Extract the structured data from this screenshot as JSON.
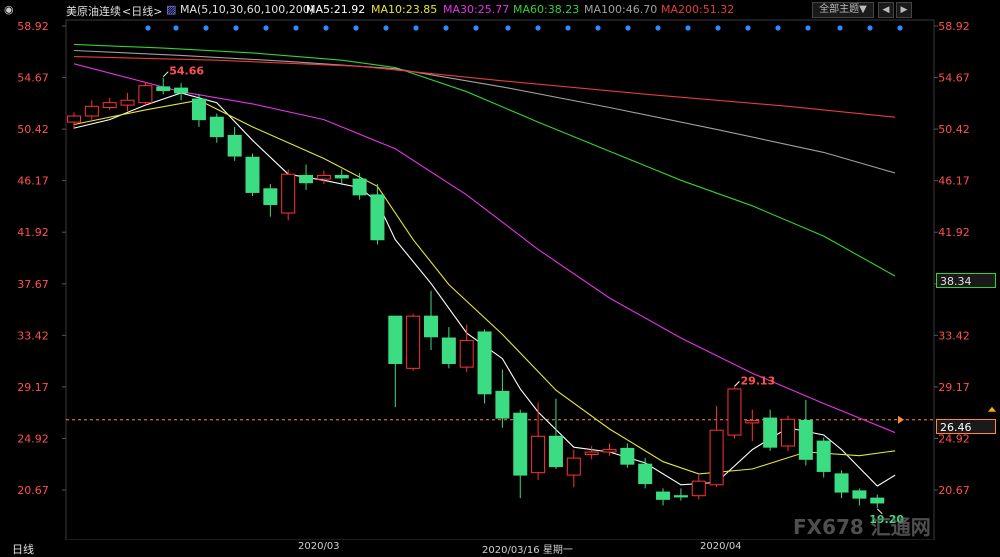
{
  "header": {
    "title": "美原油连续",
    "period_link": "<日线>",
    "ma_params": "MA(5,10,30,60,100,200)",
    "ma5": "MA5:21.92",
    "ma10": "MA10:23.85",
    "ma30": "MA30:25.77",
    "ma60": "MA60:38.23",
    "ma100": "MA100:46.70",
    "ma200": "MA200:51.32",
    "theme_button": "全部主题▼",
    "prev_button": "◀",
    "next_button": "▶"
  },
  "footer": {
    "period_tab": "日线",
    "date_labels": [
      "2020/03",
      "2020/03/16 星期一",
      "2020/04"
    ]
  },
  "price_tags": {
    "ma60_value": "38.34",
    "current_value": "26.46"
  },
  "colors": {
    "up": "#ff3232",
    "down": "#3cdc82",
    "ma5": "#ffffff",
    "ma10": "#e6e632",
    "ma30": "#e632e6",
    "ma60": "#32d232",
    "ma100": "#a0a0a0",
    "ma200": "#e63c3c",
    "axis_text": "#ff5050",
    "current_line": "#ff8c32"
  },
  "watermark": "FX678 汇通网",
  "chart_data": {
    "type": "candlestick",
    "title": "美原油连续 日线",
    "y_ticks": [
      58.92,
      54.67,
      50.42,
      46.17,
      41.92,
      37.67,
      33.42,
      29.17,
      24.92,
      20.67
    ],
    "ylim": [
      17.5,
      60.0
    ],
    "annotations": [
      {
        "label": "54.66",
        "index": 5,
        "value": 54.66,
        "type": "high"
      },
      {
        "label": "29.13",
        "index": 37,
        "value": 29.13,
        "type": "high"
      },
      {
        "label": "19.20",
        "index": 45,
        "value": 19.2,
        "type": "low"
      }
    ],
    "current_price": 26.46,
    "candles": [
      {
        "o": 51.0,
        "c": 51.5,
        "h": 51.8,
        "l": 50.4
      },
      {
        "o": 51.5,
        "c": 52.3,
        "h": 52.8,
        "l": 51.2
      },
      {
        "o": 52.2,
        "c": 52.6,
        "h": 53.0,
        "l": 52.0
      },
      {
        "o": 52.4,
        "c": 52.8,
        "h": 53.4,
        "l": 51.9
      },
      {
        "o": 52.6,
        "c": 54.0,
        "h": 54.3,
        "l": 52.4
      },
      {
        "o": 53.9,
        "c": 53.6,
        "h": 54.66,
        "l": 53.3
      },
      {
        "o": 53.8,
        "c": 53.4,
        "h": 54.2,
        "l": 52.8
      },
      {
        "o": 52.9,
        "c": 51.2,
        "h": 53.3,
        "l": 50.6
      },
      {
        "o": 51.4,
        "c": 49.8,
        "h": 51.7,
        "l": 49.3
      },
      {
        "o": 49.9,
        "c": 48.2,
        "h": 50.6,
        "l": 47.8
      },
      {
        "o": 48.1,
        "c": 45.2,
        "h": 48.4,
        "l": 44.9
      },
      {
        "o": 45.5,
        "c": 44.2,
        "h": 45.9,
        "l": 43.2
      },
      {
        "o": 43.5,
        "c": 46.7,
        "h": 47.1,
        "l": 42.9
      },
      {
        "o": 46.6,
        "c": 46.0,
        "h": 47.5,
        "l": 45.4
      },
      {
        "o": 46.3,
        "c": 46.6,
        "h": 47.0,
        "l": 45.9
      },
      {
        "o": 46.6,
        "c": 46.4,
        "h": 47.1,
        "l": 45.8
      },
      {
        "o": 46.3,
        "c": 45.0,
        "h": 46.8,
        "l": 44.6
      },
      {
        "o": 45.0,
        "c": 41.3,
        "h": 45.9,
        "l": 40.9
      },
      {
        "o": 35.0,
        "c": 31.1,
        "h": 35.0,
        "l": 27.5
      },
      {
        "o": 30.7,
        "c": 35.0,
        "h": 35.2,
        "l": 30.5
      },
      {
        "o": 35.0,
        "c": 33.3,
        "h": 37.1,
        "l": 32.2
      },
      {
        "o": 33.2,
        "c": 31.1,
        "h": 34.1,
        "l": 30.7
      },
      {
        "o": 30.8,
        "c": 33.0,
        "h": 34.3,
        "l": 30.4
      },
      {
        "o": 33.7,
        "c": 28.6,
        "h": 33.9,
        "l": 27.8
      },
      {
        "o": 28.8,
        "c": 26.6,
        "h": 30.6,
        "l": 25.8
      },
      {
        "o": 27.0,
        "c": 21.9,
        "h": 27.3,
        "l": 20.0
      },
      {
        "o": 22.1,
        "c": 25.1,
        "h": 27.9,
        "l": 21.5
      },
      {
        "o": 25.1,
        "c": 22.6,
        "h": 28.2,
        "l": 22.4
      },
      {
        "o": 21.9,
        "c": 23.3,
        "h": 24.0,
        "l": 20.9
      },
      {
        "o": 23.6,
        "c": 23.8,
        "h": 24.3,
        "l": 23.2
      },
      {
        "o": 23.8,
        "c": 24.0,
        "h": 24.5,
        "l": 23.5
      },
      {
        "o": 24.1,
        "c": 22.8,
        "h": 24.5,
        "l": 22.5
      },
      {
        "o": 22.8,
        "c": 21.2,
        "h": 23.3,
        "l": 20.8
      },
      {
        "o": 20.5,
        "c": 19.9,
        "h": 20.8,
        "l": 19.4
      },
      {
        "o": 20.2,
        "c": 20.1,
        "h": 20.8,
        "l": 19.8
      },
      {
        "o": 20.2,
        "c": 21.4,
        "h": 21.9,
        "l": 19.9
      },
      {
        "o": 21.1,
        "c": 25.6,
        "h": 27.6,
        "l": 20.9
      },
      {
        "o": 25.2,
        "c": 29.0,
        "h": 29.13,
        "l": 24.9
      },
      {
        "o": 26.2,
        "c": 26.4,
        "h": 27.3,
        "l": 24.7
      },
      {
        "o": 26.6,
        "c": 24.2,
        "h": 27.3,
        "l": 23.9
      },
      {
        "o": 24.3,
        "c": 26.5,
        "h": 26.8,
        "l": 23.9
      },
      {
        "o": 26.4,
        "c": 23.2,
        "h": 28.1,
        "l": 22.7
      },
      {
        "o": 24.7,
        "c": 22.2,
        "h": 25.0,
        "l": 21.7
      },
      {
        "o": 22.0,
        "c": 20.5,
        "h": 22.3,
        "l": 20.0
      },
      {
        "o": 20.6,
        "c": 20.0,
        "h": 20.8,
        "l": 19.4
      },
      {
        "o": 20.0,
        "c": 19.6,
        "h": 20.3,
        "l": 19.2
      }
    ],
    "moving_averages": [
      {
        "name": "MA5",
        "color": "#ffffff",
        "values": [
          [
            0,
            50.5
          ],
          [
            2,
            51.2
          ],
          [
            4,
            52.4
          ],
          [
            6,
            53.4
          ],
          [
            8,
            52.6
          ],
          [
            10,
            49.5
          ],
          [
            12,
            46.7
          ],
          [
            14,
            46.2
          ],
          [
            16,
            45.6
          ],
          [
            17,
            44.4
          ],
          [
            18,
            41.3
          ],
          [
            20,
            37.7
          ],
          [
            22,
            33.6
          ],
          [
            24,
            31.5
          ],
          [
            25,
            29.0
          ],
          [
            26,
            27.1
          ],
          [
            28,
            24.2
          ],
          [
            30,
            23.8
          ],
          [
            32,
            22.9
          ],
          [
            34,
            21.1
          ],
          [
            36,
            21.3
          ],
          [
            38,
            24.0
          ],
          [
            40,
            25.8
          ],
          [
            42,
            25.2
          ],
          [
            43,
            24.0
          ],
          [
            45,
            21.0
          ],
          [
            46,
            21.9
          ]
        ]
      },
      {
        "name": "MA10",
        "color": "#e6e632",
        "values": [
          [
            0,
            50.8
          ],
          [
            4,
            52.0
          ],
          [
            7,
            52.8
          ],
          [
            10,
            50.6
          ],
          [
            14,
            48.0
          ],
          [
            17,
            45.7
          ],
          [
            19,
            41.3
          ],
          [
            21,
            37.6
          ],
          [
            24,
            33.5
          ],
          [
            27,
            28.9
          ],
          [
            30,
            25.7
          ],
          [
            33,
            23.0
          ],
          [
            35,
            22.0
          ],
          [
            38,
            22.4
          ],
          [
            41,
            23.8
          ],
          [
            44,
            23.5
          ],
          [
            46,
            23.9
          ]
        ]
      },
      {
        "name": "MA30",
        "color": "#e632e6",
        "values": [
          [
            0,
            55.8
          ],
          [
            6,
            53.5
          ],
          [
            10,
            52.5
          ],
          [
            14,
            51.2
          ],
          [
            18,
            48.8
          ],
          [
            22,
            45.0
          ],
          [
            26,
            40.5
          ],
          [
            30,
            36.5
          ],
          [
            34,
            33.2
          ],
          [
            38,
            30.3
          ],
          [
            42,
            27.8
          ],
          [
            46,
            25.4
          ]
        ]
      },
      {
        "name": "MA60",
        "color": "#32d232",
        "values": [
          [
            0,
            57.4
          ],
          [
            5,
            57.1
          ],
          [
            10,
            56.7
          ],
          [
            15,
            56.1
          ],
          [
            18,
            55.5
          ],
          [
            22,
            53.5
          ],
          [
            26,
            51.0
          ],
          [
            30,
            48.6
          ],
          [
            34,
            46.2
          ],
          [
            38,
            44.1
          ],
          [
            42,
            41.6
          ],
          [
            46,
            38.3
          ]
        ]
      },
      {
        "name": "MA100",
        "color": "#a0a0a0",
        "values": [
          [
            0,
            56.9
          ],
          [
            6,
            56.5
          ],
          [
            12,
            56.0
          ],
          [
            18,
            55.4
          ],
          [
            24,
            53.9
          ],
          [
            30,
            52.2
          ],
          [
            36,
            50.4
          ],
          [
            42,
            48.5
          ],
          [
            46,
            46.8
          ]
        ]
      },
      {
        "name": "MA200",
        "color": "#e63c3c",
        "values": [
          [
            0,
            56.4
          ],
          [
            8,
            56.1
          ],
          [
            16,
            55.6
          ],
          [
            24,
            54.4
          ],
          [
            32,
            53.3
          ],
          [
            40,
            52.3
          ],
          [
            46,
            51.4
          ]
        ]
      }
    ]
  }
}
